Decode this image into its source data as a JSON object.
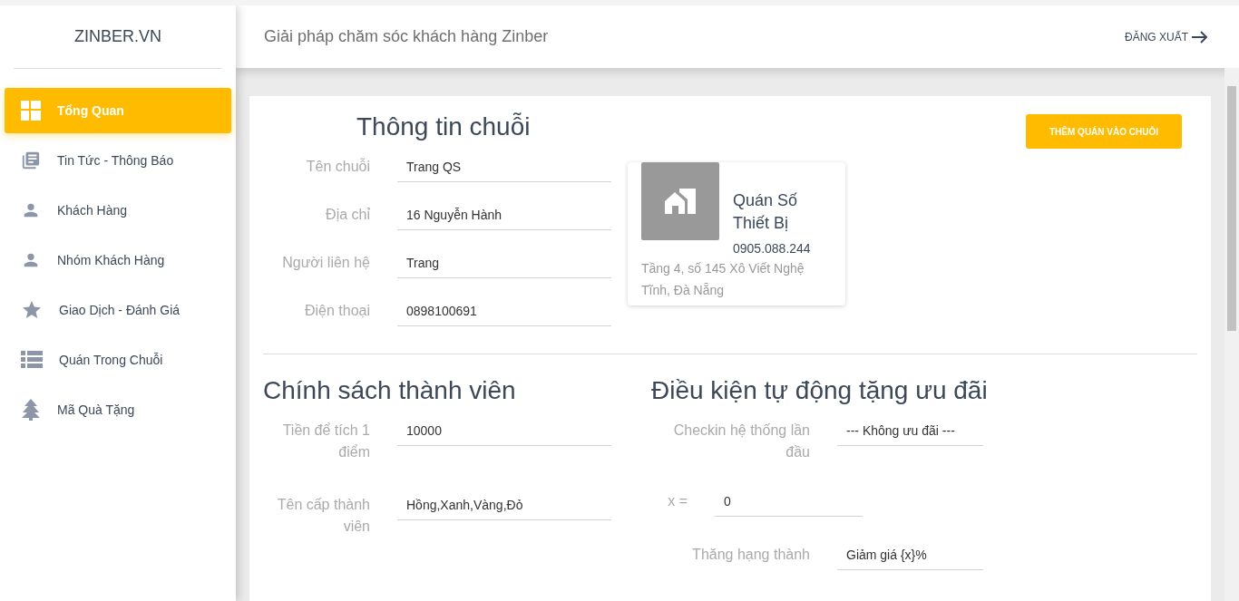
{
  "sidebar": {
    "brand": "ZINBER.VN",
    "items": [
      {
        "label": "Tổng Quan",
        "selected": true
      },
      {
        "label": "Tin Tức - Thông Báo",
        "selected": false
      },
      {
        "label": "Khách Hàng",
        "selected": false
      },
      {
        "label": "Nhóm Khách Hàng",
        "selected": false
      },
      {
        "label": "Giao Dịch - Đánh Giá",
        "selected": false
      },
      {
        "label": "Quán Trong Chuỗi",
        "selected": false
      },
      {
        "label": "Mã Quà Tặng",
        "selected": false
      }
    ]
  },
  "header": {
    "title": "Giải pháp chăm sóc khách hàng Zinber",
    "logout": "ĐĂNG XUẤT"
  },
  "chain_info": {
    "title": "Thông tin chuỗi",
    "fields": [
      {
        "label": "Tên chuỗi",
        "value": "Trang QS"
      },
      {
        "label": "Địa chỉ",
        "value": "16 Nguyễn Hành"
      },
      {
        "label": "Người liên hệ",
        "value": "Trang"
      },
      {
        "label": "Điện thoại",
        "value": "0898100691"
      }
    ]
  },
  "add_store_button": "THÊM QUÁN VÀO CHUỖI",
  "store_card": {
    "name": "Quán Số Thiết Bị",
    "phone": "0905.088.244",
    "address": "Tầng 4, số 145 Xô Viết Nghệ Tĩnh, Đà Nẵng"
  },
  "member_policy": {
    "title": "Chính sách thành viên",
    "fields": [
      {
        "label": "Tiền để tích 1 điểm",
        "value": "10000"
      },
      {
        "label": "Tên cấp thành viên",
        "value": "Hồng,Xanh,Vàng,Đỏ"
      }
    ]
  },
  "auto_offer": {
    "title": "Điều kiện tự động tặng ưu đãi",
    "fields": [
      {
        "kind": "select",
        "label": "Checkin hệ thống lần đầu",
        "value": "--- Không ưu đãi ---"
      },
      {
        "kind": "inline",
        "label": "x =",
        "value": "0"
      },
      {
        "kind": "select",
        "label": "Thăng hạng thành",
        "value": "Giảm giá {x}%"
      }
    ]
  }
}
